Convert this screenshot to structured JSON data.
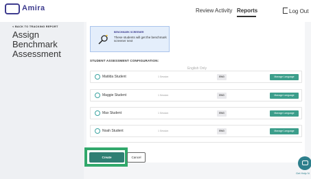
{
  "topbar": {
    "logo_text": "Amira",
    "nav": {
      "review": "Review Activity",
      "reports": "Reports"
    },
    "logout": "Log Out"
  },
  "left": {
    "back": "< BACK TO TRACKING REPORT",
    "title": "Assign Benchmark Assessment"
  },
  "banner": {
    "title": "BENCHMARK SCREENER",
    "text": "These students will get the benchmark screener next"
  },
  "config": {
    "label": "STUDENT ASSESSMENT CONFIGURATION:",
    "english_only": "English Only"
  },
  "students": [
    {
      "name": "Matilda Student",
      "session": "1 Session",
      "lang": "ENG",
      "btn": "Manage Language"
    },
    {
      "name": "Maggie Student",
      "session": "1 Session",
      "lang": "ENG",
      "btn": "Manage Language"
    },
    {
      "name": "Max Student",
      "session": "1 Session",
      "lang": "ENG",
      "btn": "Manage Language"
    },
    {
      "name": "Noah Student",
      "session": "1 Session",
      "lang": "ENG",
      "btn": "Manage Language"
    }
  ],
  "actions": {
    "create": "Create",
    "cancel": "Cancel"
  },
  "help": {
    "label": "Get Help N"
  },
  "colors": {
    "accent": "#2f7f73",
    "highlight": "#31a86b",
    "brand": "#3d3b8e"
  }
}
